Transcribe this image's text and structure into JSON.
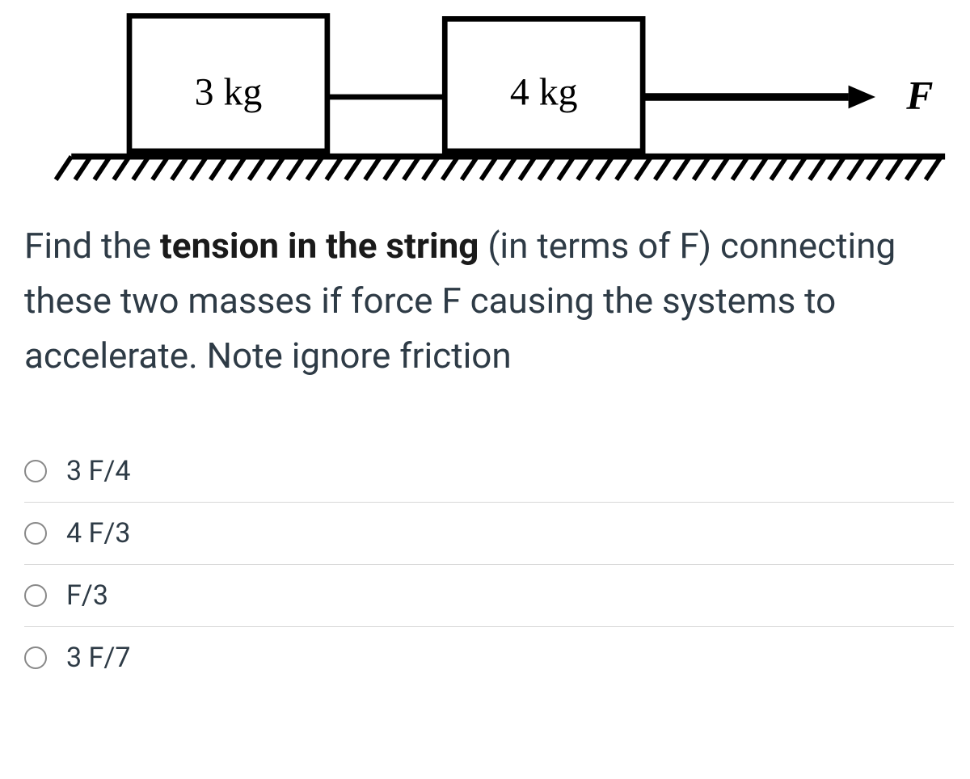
{
  "diagram": {
    "block1_label": "3 kg",
    "block2_label": "4 kg",
    "force_label": "F"
  },
  "question": {
    "part1": "Find the ",
    "bold": "tension in the string",
    "part2": " (in terms of F) connecting these two masses if force F causing the systems to accelerate. Note ignore friction"
  },
  "options": [
    {
      "label": "3 F/4"
    },
    {
      "label": "4 F/3"
    },
    {
      "label": "F/3"
    },
    {
      "label": "3 F/7"
    }
  ]
}
